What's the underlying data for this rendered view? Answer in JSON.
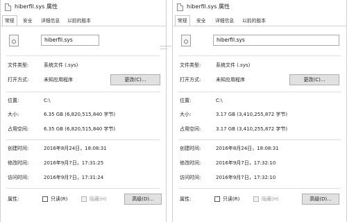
{
  "dialogs": [
    {
      "title": "hiberfil.sys 属性",
      "tabs": [
        "常规",
        "安全",
        "详细信息",
        "以前的版本"
      ],
      "filename": "hiberfil.sys",
      "type_label": "文件类型:",
      "type_value": "系统文件 (.sys)",
      "open_label": "打开方式:",
      "open_value": "未知应用程序",
      "change_button": "更改(C)...",
      "location_label": "位置:",
      "location_value": "C:\\",
      "size_label": "大小:",
      "size_value": "6.35 GB (6,820,515,840 字节)",
      "disk_label": "占用空间:",
      "disk_value": "6.35 GB (6,820,515,840 字节)",
      "created_label": "创建时间:",
      "created_value": "2016年8月24日，18:08:31",
      "modified_label": "修改时间:",
      "modified_value": "2016年9月7日，17:31:25",
      "accessed_label": "访问时间:",
      "accessed_value": "2016年9月7日，17:31:24",
      "attributes_label": "属性:",
      "readonly_label": "只读(R)",
      "hidden_label": "隐藏(H)",
      "advanced_button": "高级(D)..."
    },
    {
      "title": "hiberfil.sys 属性",
      "tabs": [
        "常规",
        "安全",
        "详细信息",
        "以前的版本"
      ],
      "filename": "hiberfil.sys",
      "type_label": "文件类型:",
      "type_value": "系统文件 (.sys)",
      "open_label": "打开方式:",
      "open_value": "未知应用程序",
      "change_button": "更改(C)...",
      "location_label": "位置:",
      "location_value": "C:\\",
      "size_label": "大小:",
      "size_value": "3.17 GB (3,410,255,872 字节)",
      "disk_label": "占用空间:",
      "disk_value": "3.17 GB (3,410,255,872 字节)",
      "created_label": "创建时间:",
      "created_value": "2016年8月24日，18:08:31",
      "modified_label": "修改时间:",
      "modified_value": "2016年9月7日，17:32:10",
      "accessed_label": "访问时间:",
      "accessed_value": "2016年9月7日，17:32:10",
      "attributes_label": "属性:",
      "readonly_label": "只读(R)",
      "hidden_label": "隐藏(H)",
      "advanced_button": "高级(D)..."
    }
  ]
}
